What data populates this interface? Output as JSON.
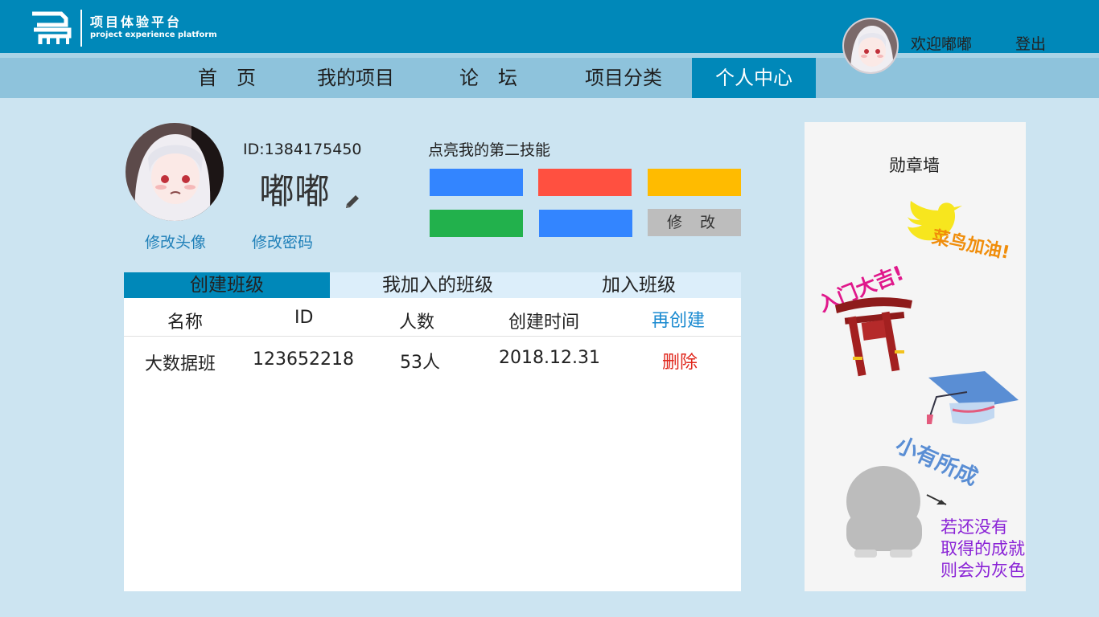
{
  "header": {
    "logo_cn": "项目体验平台",
    "logo_en": "project experience platform",
    "welcome": "欢迎嘟嘟",
    "logout": "登出"
  },
  "nav": {
    "items": [
      "首　页",
      "我的项目",
      "论　坛",
      "项目分类",
      "个人中心"
    ],
    "active": "个人中心"
  },
  "profile": {
    "id": "ID:1384175450",
    "nickname": "嘟嘟",
    "edit_avatar": "修改头像",
    "edit_password": "修改密码"
  },
  "skills": {
    "title": "点亮我的第二技能",
    "colors": [
      "#3385ff",
      "#ff5040",
      "#ffbb00",
      "#22b14c",
      "#3385ff"
    ],
    "edit_label": "修 改"
  },
  "classes": {
    "tabs": [
      "创建班级",
      "我加入的班级",
      "加入班级"
    ],
    "active_tab": "创建班级",
    "columns": [
      "名称",
      "ID",
      "人数",
      "创建时间"
    ],
    "action_header": "再创建",
    "rows": [
      {
        "name": "大数据班",
        "id": "123652218",
        "count": "53人",
        "created": "2018.12.31",
        "action": "删除"
      }
    ]
  },
  "badges": {
    "title": "勋章墙",
    "items": [
      "菜鸟加油!",
      "入门大吉!",
      "小有所成"
    ],
    "note": [
      "若还没有",
      "取得的成就",
      "则会为灰色"
    ]
  },
  "colors": {
    "header": "#0088b9",
    "nav": "#8ec3dc",
    "background": "#cce4f1",
    "link": "#1e7fb8",
    "delete": "#e0261b",
    "note": "#8a22d6"
  }
}
